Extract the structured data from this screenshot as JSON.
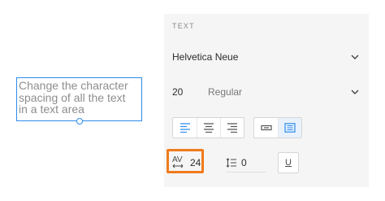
{
  "canvas": {
    "textbox_lines": [
      "Change the character",
      "spacing of all the text",
      "in a text area"
    ]
  },
  "panel": {
    "section_label": "TEXT",
    "font_family": "Helvetica Neue",
    "font_size": "20",
    "font_weight": "Regular",
    "character_spacing": "24",
    "line_spacing": "0",
    "underline_label": "U",
    "char_spacing_glyph": "AV"
  },
  "colors": {
    "accent": "#2d8ceb",
    "highlight": "#f07c1c",
    "panel_bg": "#f5f5f5"
  }
}
